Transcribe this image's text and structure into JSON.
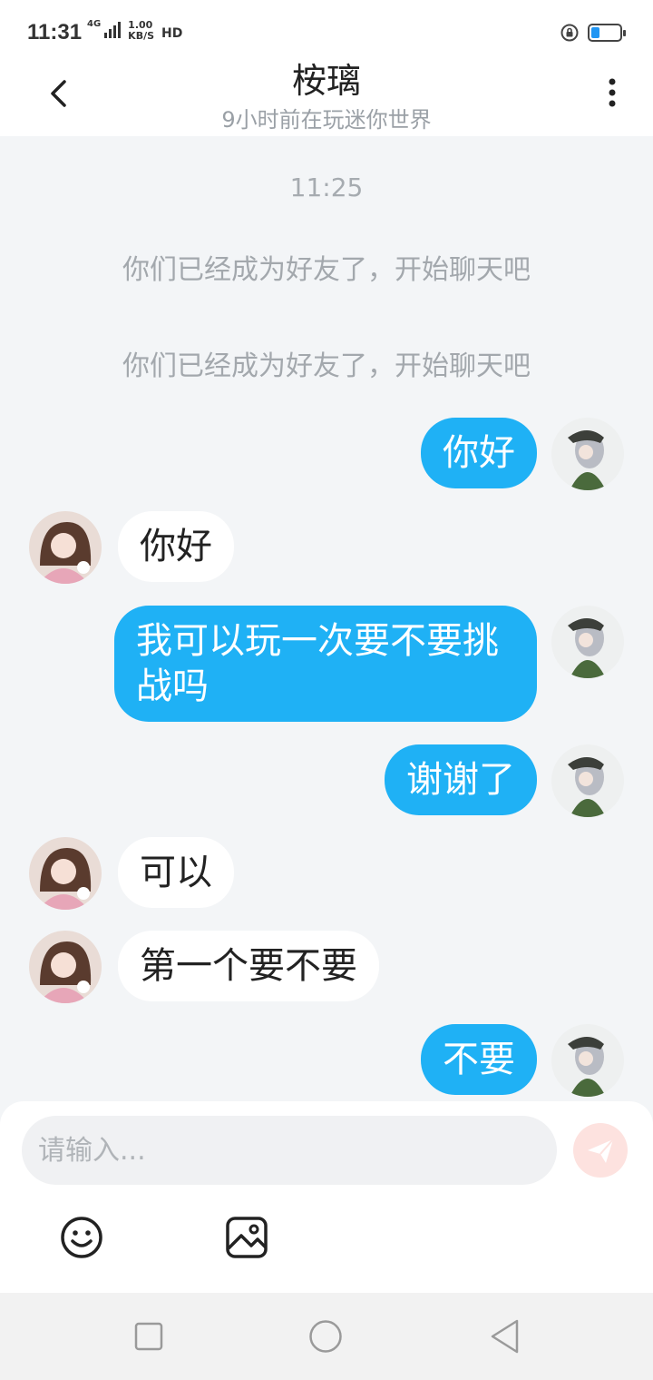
{
  "status_bar": {
    "time": "11:31",
    "network": "4G",
    "speed_value": "1.00",
    "speed_unit": "KB/S",
    "hd": "HD",
    "battery_level": 0.3,
    "accent_color": "#2196f3"
  },
  "header": {
    "title": "桉璃",
    "subtitle": "9小时前在玩迷你世界",
    "back_icon": "chevron-left-icon",
    "more_icon": "more-vertical-icon"
  },
  "chat": {
    "timestamp": "11:25",
    "system_messages": [
      "你们已经成为好友了，开始聊天吧",
      "你们已经成为好友了，开始聊天吧"
    ],
    "messages": [
      {
        "side": "me",
        "text": "你好"
      },
      {
        "side": "other",
        "text": "你好"
      },
      {
        "side": "me",
        "text": "我可以玩一次要不要挑战吗"
      },
      {
        "side": "me",
        "text": "谢谢了"
      },
      {
        "side": "other",
        "text": "可以"
      },
      {
        "side": "other",
        "text": "第一个要不要"
      },
      {
        "side": "me",
        "text": "不要"
      }
    ],
    "me_bubble_color": "#1fb1f5",
    "other_bubble_color": "#ffffff"
  },
  "input": {
    "placeholder": "请输入...",
    "send_icon": "send-plane-icon",
    "emoji_icon": "smiley-icon",
    "image_icon": "image-icon"
  },
  "nav": {
    "recents_icon": "square-icon",
    "home_icon": "circle-icon",
    "back_icon": "triangle-back-icon"
  }
}
